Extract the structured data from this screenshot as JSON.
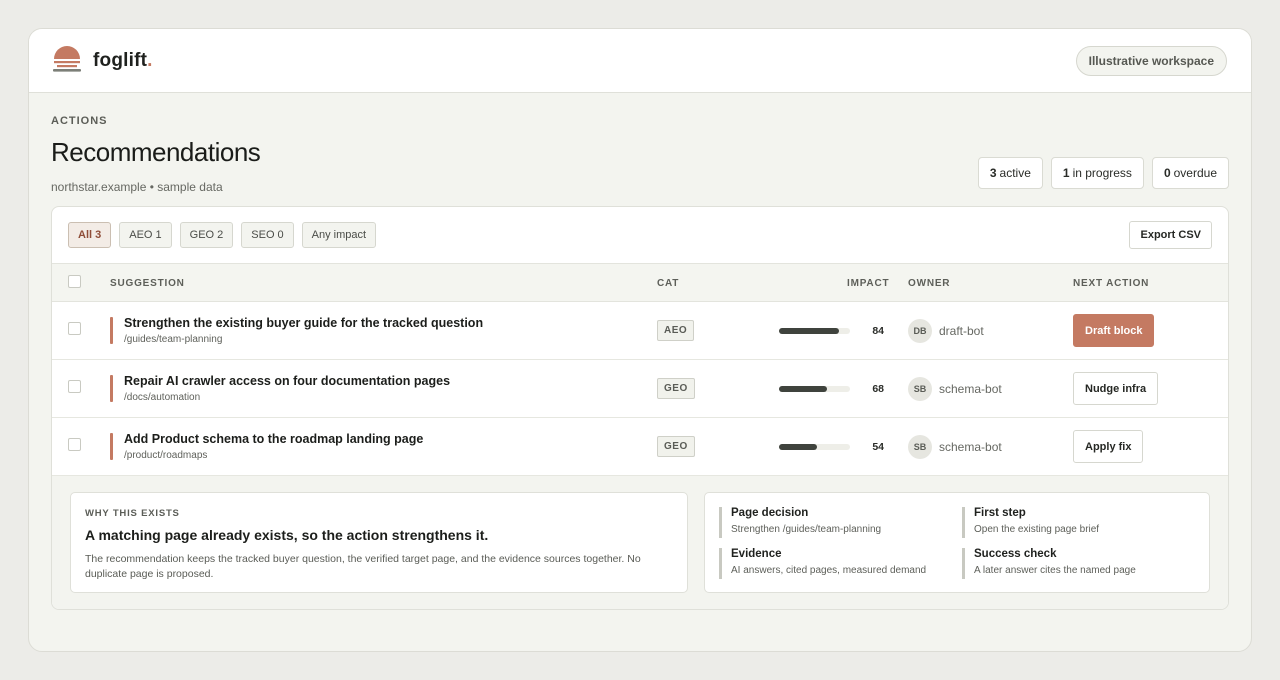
{
  "brand": {
    "name": "foglift",
    "dot": "."
  },
  "workspace": "Illustrative workspace",
  "header": {
    "eyebrow": "ACTIONS",
    "title": "Recommendations",
    "subtitle": "northstar.example • sample data"
  },
  "stats": [
    {
      "value": "3",
      "label": "active"
    },
    {
      "value": "1",
      "label": "in progress"
    },
    {
      "value": "0",
      "label": "overdue"
    }
  ],
  "filters": [
    {
      "label": "All 3"
    },
    {
      "label": "AEO 1"
    },
    {
      "label": "GEO 2"
    },
    {
      "label": "SEO 0"
    },
    {
      "label": "Any impact"
    }
  ],
  "export_label": "Export CSV",
  "columns": {
    "suggestion": "SUGGESTION",
    "cat": "CAT",
    "impact": "IMPACT",
    "owner": "OWNER",
    "next_action": "NEXT ACTION"
  },
  "rows": [
    {
      "title": "Strengthen the existing buyer guide for the tracked question",
      "path": "/guides/team-planning",
      "cat": "AEO",
      "impact": 84,
      "initials": "DB",
      "owner": "draft-bot",
      "action": "Draft block"
    },
    {
      "title": "Repair AI crawler access on four documentation pages",
      "path": "/docs/automation",
      "cat": "GEO",
      "impact": 68,
      "initials": "SB",
      "owner": "schema-bot",
      "action": "Nudge infra"
    },
    {
      "title": "Add Product schema to the roadmap landing page",
      "path": "/product/roadmaps",
      "cat": "GEO",
      "impact": 54,
      "initials": "SB",
      "owner": "schema-bot",
      "action": "Apply fix"
    }
  ],
  "why": {
    "eyebrow": "WHY THIS EXISTS",
    "title": "A matching page already exists, so the action strengthens it.",
    "body": "The recommendation keeps the tracked buyer question, the verified target page, and the evidence sources together. No duplicate page is proposed."
  },
  "facts": [
    {
      "label": "Page decision",
      "value": "Strengthen /guides/team-planning"
    },
    {
      "label": "First step",
      "value": "Open the existing page brief"
    },
    {
      "label": "Evidence",
      "value": "AI answers, cited pages, measured demand"
    },
    {
      "label": "Success check",
      "value": "A later answer cites the named page"
    }
  ],
  "colors": {
    "accent": "#c47a62",
    "bar": "#3f433d",
    "background": "#f3f4ef"
  },
  "icons": {
    "logo": "sunset-logo-icon",
    "checkbox": "checkbox-icon"
  }
}
